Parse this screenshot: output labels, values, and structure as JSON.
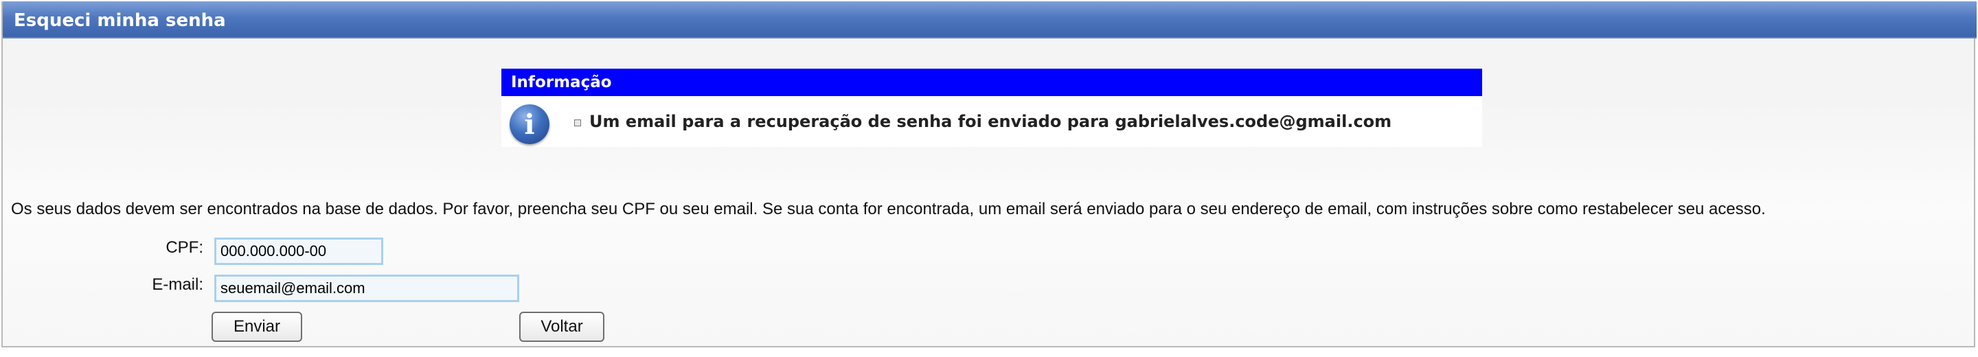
{
  "header": {
    "title": "Esqueci minha senha"
  },
  "info": {
    "heading": "Informação",
    "icon": "info-icon",
    "message": "Um email para a recuperação de senha foi enviado para gabrielalves.code@gmail.com"
  },
  "description": "Os seus dados devem ser encontrados na base de dados. Por favor, preencha seu CPF ou seu email. Se sua conta for encontrada, um email será enviado para o seu endereço de email, com instruções sobre como restabelecer seu acesso.",
  "form": {
    "cpf_label": "CPF:",
    "cpf_value": "000.000.000-00",
    "email_label": "E-mail:",
    "email_value": "seuemail@email.com"
  },
  "buttons": {
    "submit": "Enviar",
    "back": "Voltar"
  },
  "colors": {
    "title_bar": "#4f77bf",
    "info_header": "#0000ff",
    "field_border": "#a9d0ef"
  }
}
